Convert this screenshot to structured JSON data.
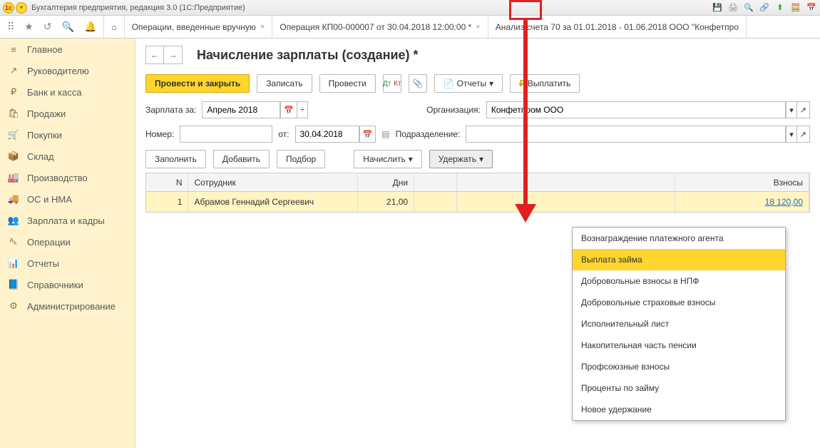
{
  "titlebar": {
    "text": "Бухгалтерия предприятия, редакция 3.0  (1С:Предприятие)"
  },
  "tabs": [
    {
      "label": "Операции, введенные вручную",
      "closable": true
    },
    {
      "label": "Операция КП00-000007 от 30.04.2018 12:00:00 *",
      "closable": true
    },
    {
      "label": "Анализ счета 70 за 01.01.2018 - 01.06.2018 ООО \"Конфетпро"
    }
  ],
  "sidebar": {
    "items": [
      {
        "icon": "≡",
        "label": "Главное"
      },
      {
        "icon": "↗",
        "label": "Руководителю"
      },
      {
        "icon": "₽",
        "label": "Банк и касса"
      },
      {
        "icon": "🛍",
        "label": "Продажи"
      },
      {
        "icon": "🛒",
        "label": "Покупки"
      },
      {
        "icon": "📦",
        "label": "Склад"
      },
      {
        "icon": "🏭",
        "label": "Производство"
      },
      {
        "icon": "🚚",
        "label": "ОС и НМА"
      },
      {
        "icon": "👥",
        "label": "Зарплата и кадры"
      },
      {
        "icon": "ᴬₖ",
        "label": "Операции"
      },
      {
        "icon": "📊",
        "label": "Отчеты"
      },
      {
        "icon": "📘",
        "label": "Справочники"
      },
      {
        "icon": "⚙",
        "label": "Администрирование"
      }
    ]
  },
  "page": {
    "title": "Начисление зарплаты (создание) *",
    "buttons": {
      "post_close": "Провести и закрыть",
      "save": "Записать",
      "post": "Провести",
      "reports": "Отчеты",
      "pay": "Выплатить"
    },
    "form": {
      "salary_for_label": "Зарплата за:",
      "salary_for_value": "Апрель 2018",
      "org_label": "Организация:",
      "org_value": "Конфетпром ООО",
      "number_label": "Номер:",
      "number_value": "",
      "from_label": "от:",
      "from_value": "30.04.2018",
      "dept_label": "Подразделение:",
      "dept_value": ""
    },
    "tbl_buttons": {
      "fill": "Заполнить",
      "add": "Добавить",
      "pick": "Подбор",
      "accrue": "Начислить",
      "deduct": "Удержать"
    },
    "table": {
      "headers": {
        "n": "N",
        "emp": "Сотрудник",
        "days": "Дни",
        "hours": "",
        "accr": "",
        "fees": "Взносы"
      },
      "rows": [
        {
          "n": "1",
          "emp": "Абрамов Геннадий Сергеевич",
          "days": "21,00",
          "fees": "18 120,00"
        }
      ]
    }
  },
  "dropdown": {
    "items": [
      "Вознаграждение платежного агента",
      "Выплата займа",
      "Добровольные взносы в НПФ",
      "Добровольные страховые взносы",
      "Исполнительный лист",
      "Накопительная часть пенсии",
      "Профсоюзные взносы",
      "Проценты по займу",
      "Новое удержание"
    ],
    "hovered_index": 1
  }
}
